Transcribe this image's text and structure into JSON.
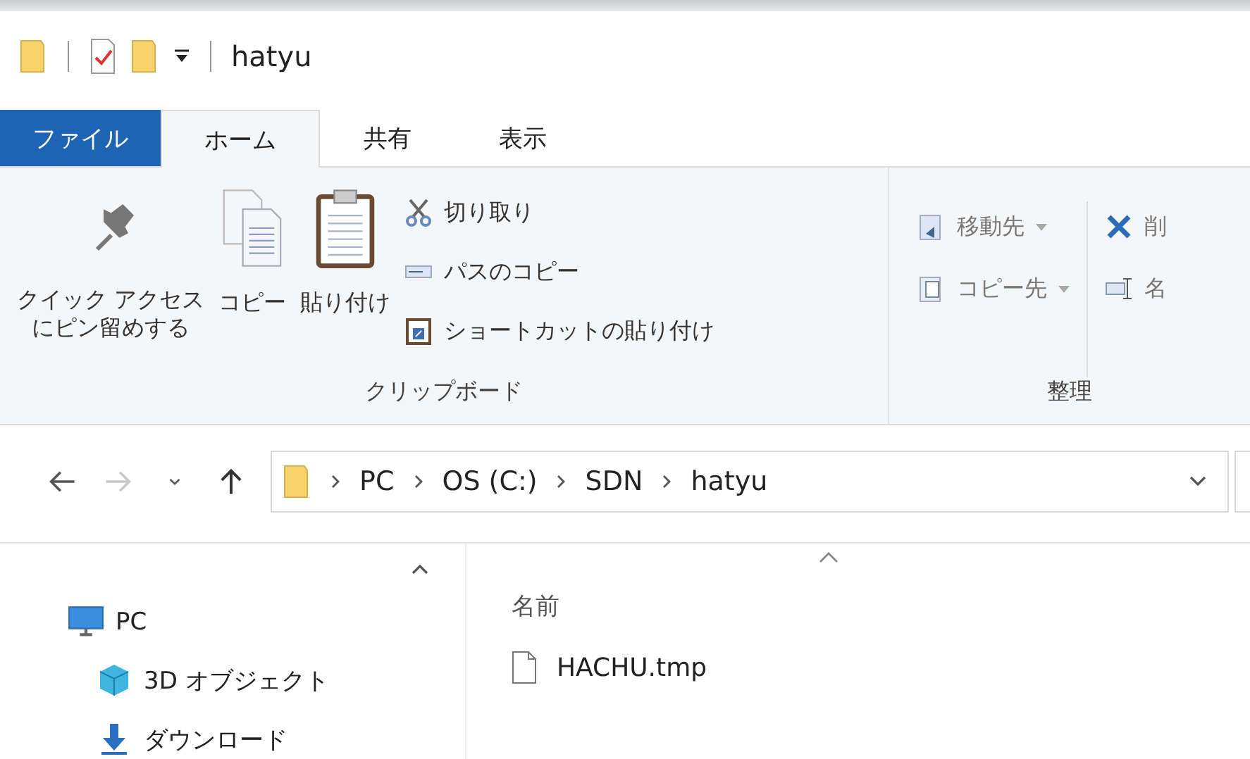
{
  "title_bar": {
    "title": "hatyu"
  },
  "tabs": [
    {
      "label": "ファイル",
      "kind": "file",
      "selected": false
    },
    {
      "label": "ホーム",
      "kind": "tab",
      "selected": true
    },
    {
      "label": "共有",
      "kind": "tab",
      "selected": false
    },
    {
      "label": "表示",
      "kind": "tab",
      "selected": false
    }
  ],
  "clipboard_group": {
    "label": "クリップボード",
    "large_buttons": [
      {
        "lines": [
          "クイック アクセス",
          "にピン留めする"
        ],
        "kind": "pin"
      },
      {
        "lines": [
          "コピー"
        ],
        "kind": "copy"
      },
      {
        "lines": [
          "貼り付け"
        ],
        "kind": "paste"
      }
    ],
    "small_buttons": [
      {
        "label": "切り取り",
        "kind": "cut"
      },
      {
        "label": "パスのコピー",
        "kind": "path"
      },
      {
        "label": "ショートカットの貼り付け",
        "kind": "shortcut"
      }
    ]
  },
  "organize_group": {
    "label": "整理",
    "columns": [
      [
        {
          "label": "移動先",
          "kind": "move",
          "dropdown": true
        },
        {
          "label": "コピー先",
          "kind": "copyto",
          "dropdown": true
        }
      ],
      [
        {
          "label": "削",
          "kind": "delete",
          "dropdown": false
        },
        {
          "label": "名",
          "kind": "rename",
          "dropdown": false
        }
      ]
    ]
  },
  "nav_buttons": [
    {
      "kind": "back",
      "disabled": false
    },
    {
      "kind": "forward",
      "disabled": true
    },
    {
      "kind": "recent",
      "disabled": false
    },
    {
      "kind": "up",
      "disabled": false
    }
  ],
  "breadcrumbs": [
    "PC",
    "OS (C:)",
    "SDN",
    "hatyu"
  ],
  "nav_pane": [
    {
      "label": "PC",
      "kind": "pc",
      "children": [
        {
          "label": "3D オブジェクト",
          "kind": "cube"
        },
        {
          "label": "ダウンロード",
          "kind": "download"
        }
      ]
    }
  ],
  "file_list": {
    "columns": [
      "名前"
    ],
    "rows": [
      {
        "name": "HACHU.tmp",
        "kind": "file"
      }
    ]
  }
}
